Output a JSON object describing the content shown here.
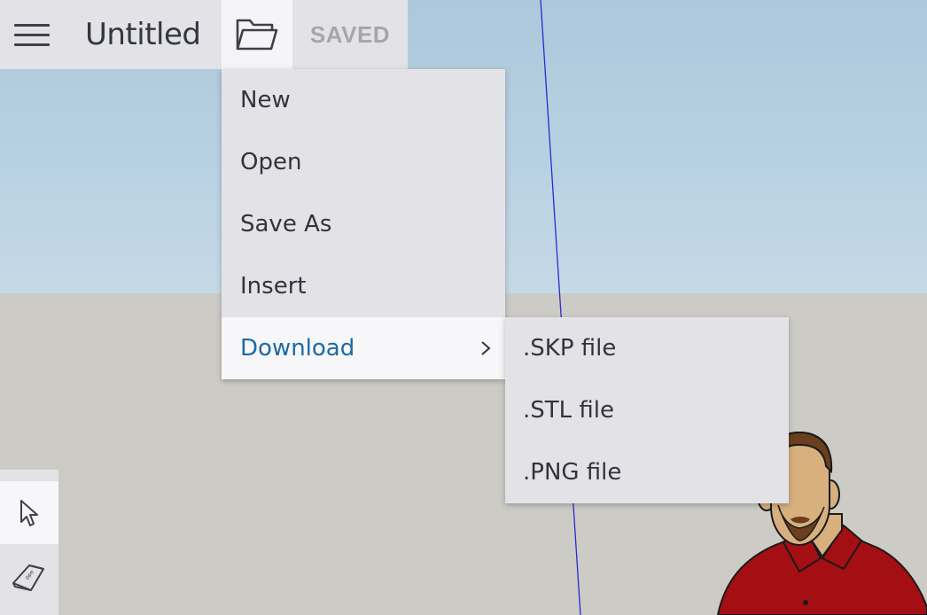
{
  "app": {
    "title": "Untitled",
    "save_status": "SAVED"
  },
  "toolbar": {
    "menu_icon": "hamburger-menu-icon",
    "file_icon": "folder-open-icon"
  },
  "file_menu": {
    "items": [
      {
        "label": "New"
      },
      {
        "label": "Open"
      },
      {
        "label": "Save As"
      },
      {
        "label": "Insert"
      },
      {
        "label": "Download",
        "active": true,
        "has_submenu": true
      }
    ]
  },
  "download_submenu": {
    "items": [
      {
        "label": ".SKP file"
      },
      {
        "label": ".STL file"
      },
      {
        "label": ".PNG file"
      }
    ]
  },
  "tools": {
    "select_icon": "select-arrow-icon",
    "eraser_icon": "eraser-icon"
  },
  "colors": {
    "sky": "#b8d1e2",
    "ground": "#cccbc5",
    "menu_bg": "#e3e3e7",
    "active_text": "#1d6aa5",
    "axis_blue": "#2222cc",
    "shirt_red": "#a30f12"
  }
}
